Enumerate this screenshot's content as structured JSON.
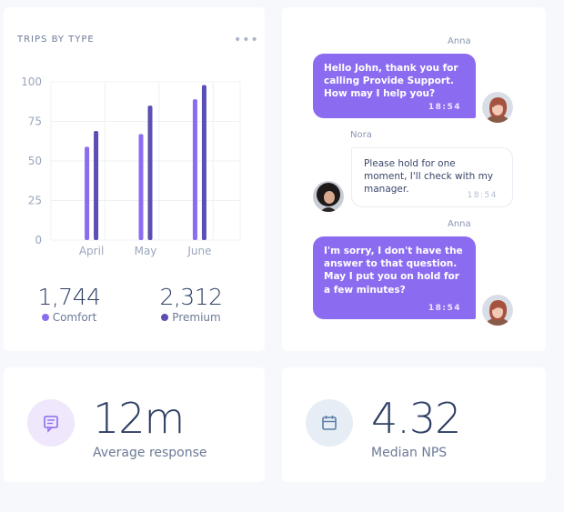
{
  "trips_card": {
    "title": "TRIPS BY TYPE",
    "more_icon": "more-horizontal-icon",
    "stats": [
      {
        "value": "1,744",
        "label": "Comfort",
        "color": "#8b6cf0"
      },
      {
        "value": "2,312",
        "label": "Premium",
        "color": "#5a4fb5"
      }
    ]
  },
  "chart_data": {
    "type": "bar",
    "categories": [
      "April",
      "May",
      "June"
    ],
    "series": [
      {
        "name": "Comfort",
        "values": [
          59,
          67,
          89
        ],
        "color": "#8b6cf0"
      },
      {
        "name": "Premium",
        "values": [
          69,
          85,
          98
        ],
        "color": "#5a4fb5"
      }
    ],
    "ylim": [
      0,
      100
    ],
    "yticks": [
      0,
      25,
      50,
      75,
      100
    ],
    "grid": true,
    "title": "",
    "xlabel": "",
    "ylabel": ""
  },
  "chat": {
    "messages": [
      {
        "sender": "Anna",
        "direction": "out",
        "text": "Hello John, thank you for calling Provide Support. How may I help you?",
        "time": "18:54",
        "avatar": "anna-avatar"
      },
      {
        "sender": "Nora",
        "direction": "in",
        "text": "Please hold for one moment, I'll check with my manager.",
        "time": "18:54",
        "avatar": "nora-avatar"
      },
      {
        "sender": "Anna",
        "direction": "out",
        "text": "I'm sorry, I don't have the answer to that question. May I put you on hold for a few minutes?",
        "time": "18:54",
        "avatar": "anna-avatar"
      }
    ]
  },
  "kpis": {
    "response": {
      "value": "12m",
      "label": "Average response",
      "icon": "message-icon",
      "icon_bg": "#efe7fb",
      "icon_color": "#8b6cf0"
    },
    "nps": {
      "value": "4.32",
      "label": "Median NPS",
      "icon": "calendar-icon",
      "icon_bg": "#e6edf4",
      "icon_color": "#5b7fa8"
    }
  }
}
